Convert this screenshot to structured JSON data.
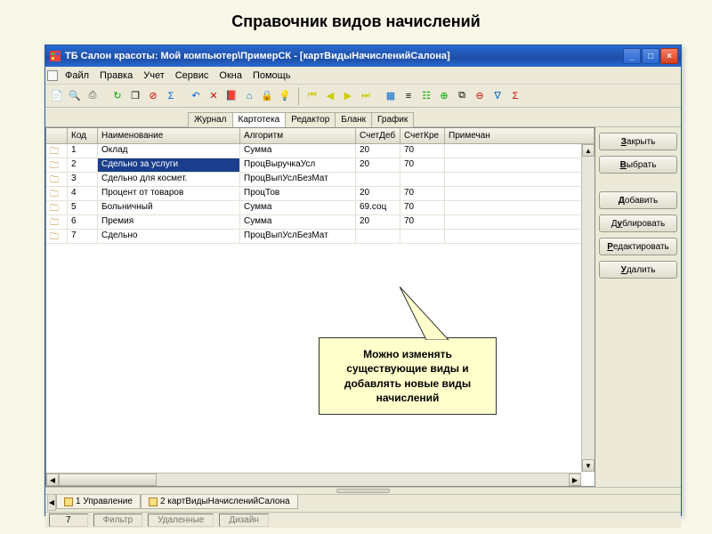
{
  "page_title": "Справочник видов начислений",
  "titlebar": "ТБ Салон красоты: Мой компьютер\\ПримерСК - [картВидыНачисленийСалона]",
  "menu": [
    "Файл",
    "Правка",
    "Учет",
    "Сервис",
    "Окна",
    "Помощь"
  ],
  "subtabs": [
    "Журнал",
    "Картотека",
    "Редактор",
    "Бланк",
    "График"
  ],
  "active_subtab": 1,
  "columns": [
    "Код",
    "Наименование",
    "Алгоритм",
    "СчетДеб",
    "СчетКре",
    "Примечан"
  ],
  "rows": [
    {
      "code": "1",
      "name": "Оклад",
      "alg": "Сумма",
      "deb": "20",
      "kre": "70"
    },
    {
      "code": "2",
      "name": "Сдельно за услуги",
      "alg": "ПроцВыручкаУсл",
      "deb": "20",
      "kre": "70",
      "selected": true
    },
    {
      "code": "3",
      "name": "Сдельно для космет.",
      "alg": "ПроцВыпУслБезМат",
      "deb": "",
      "kre": ""
    },
    {
      "code": "4",
      "name": "Процент от товаров",
      "alg": "ПроцТов",
      "deb": "20",
      "kre": "70"
    },
    {
      "code": "5",
      "name": "Больничный",
      "alg": "Сумма",
      "deb": "69.соц",
      "kre": "70"
    },
    {
      "code": "6",
      "name": "Премия",
      "alg": "Сумма",
      "deb": "20",
      "kre": "70"
    },
    {
      "code": "7",
      "name": "Сдельно",
      "alg": "ПроцВыпУслБезМат",
      "deb": "",
      "kre": ""
    }
  ],
  "side_buttons": {
    "close": "Закрыть",
    "choose": "Выбрать",
    "add": "Добавить",
    "dup": "Дублировать",
    "edit": "Редактировать",
    "delete": "Удалить"
  },
  "callout": "Можно изменять существующие виды и добавлять новые виды начислений",
  "bottom_tabs": [
    "1 Управление",
    "2 картВидыНачисленийСалона"
  ],
  "status": {
    "count": "7",
    "filter": "Фильтр",
    "deleted": "Удаленные",
    "design": "Дизайн"
  }
}
